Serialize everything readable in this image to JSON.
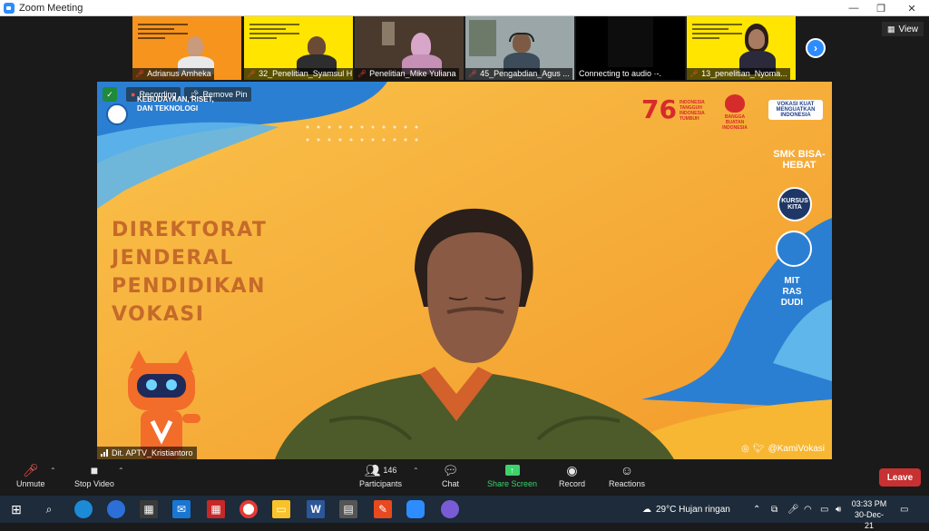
{
  "window": {
    "title": "Zoom Meeting",
    "controls": [
      "—",
      "❐",
      "✕"
    ]
  },
  "gallery": {
    "view_label": "View",
    "thumbnails": [
      {
        "name": "Adrianus Amheka"
      },
      {
        "name": "32_Penelitian_Syamsul H..."
      },
      {
        "name": "Penelitian_Mike Yuliana"
      },
      {
        "name": "45_Pengabdian_Agus ..."
      },
      {
        "name": "Connecting to audio ·-."
      },
      {
        "name": "13_penelitian_Nyoma..."
      }
    ]
  },
  "main_video": {
    "recording_label": "Recording",
    "remove_pin_label": "Remove Pin",
    "ministry_text": [
      "KEBUDAYAAN, RISET,",
      "DAN TEKNOLOGI"
    ],
    "directorate_lines": [
      "DIREKTORAT",
      "JENDERAL",
      "PENDIDIKAN",
      "VOKASI"
    ],
    "speaker_name": "Dit. APTV_Kristiantoro",
    "social_handle": "@KamiVokasi",
    "right_logos": [
      "SMK BISA-HEBAT",
      "KURSUS KITA",
      "MIT RAS DUDI"
    ],
    "top_logos": [
      "76",
      "INDONESIA TANGGUH INDONESIA TUMBUH",
      "BANGGA BUATAN INDONESIA",
      "VOKASI KUAT MENGUATKAN INDONESIA"
    ]
  },
  "toolbar": {
    "unmute": "Unmute",
    "stop_video": "Stop Video",
    "participants": "Participants",
    "participants_count": "146",
    "chat": "Chat",
    "share_screen": "Share Screen",
    "record": "Record",
    "reactions": "Reactions",
    "leave": "Leave"
  },
  "taskbar": {
    "weather": "29°C  Hujan ringan",
    "time": "03:33 PM",
    "date": "30-Dec-21"
  }
}
